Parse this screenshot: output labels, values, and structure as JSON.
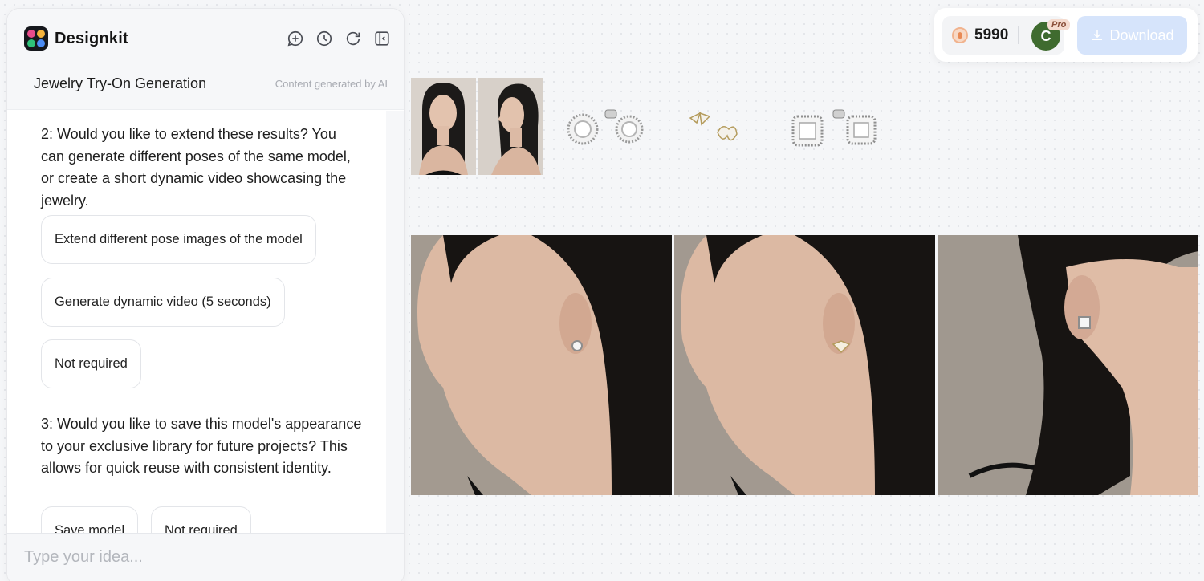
{
  "app": {
    "name": "Designkit"
  },
  "header": {
    "icons": [
      "new-chat-icon",
      "history-icon",
      "refresh-icon",
      "collapse-panel-icon"
    ],
    "session_title": "Jewelry Try-On Generation",
    "ai_note": "Content generated by AI"
  },
  "chat": {
    "question2": "2: Would you like to extend these results? You can generate different poses of the same model, or create a short dynamic video showcasing the jewelry.",
    "options2": [
      "Extend different pose images of the model",
      "Generate dynamic video (5 seconds)",
      "Not required"
    ],
    "question3": "3: Would you like to save this model's appearance to your exclusive library for future projects? This allows for quick reuse with consistent identity.",
    "options3": [
      "Save model",
      "Not required"
    ]
  },
  "input": {
    "placeholder": "Type your idea..."
  },
  "toolbar": {
    "credits": "5990",
    "avatar_initial": "C",
    "badge": "Pro",
    "download_label": "Download"
  },
  "colors": {
    "accent_disabled": "#d6e4fb",
    "avatar": "#3f6b2f",
    "background": "#f5f6f8"
  }
}
